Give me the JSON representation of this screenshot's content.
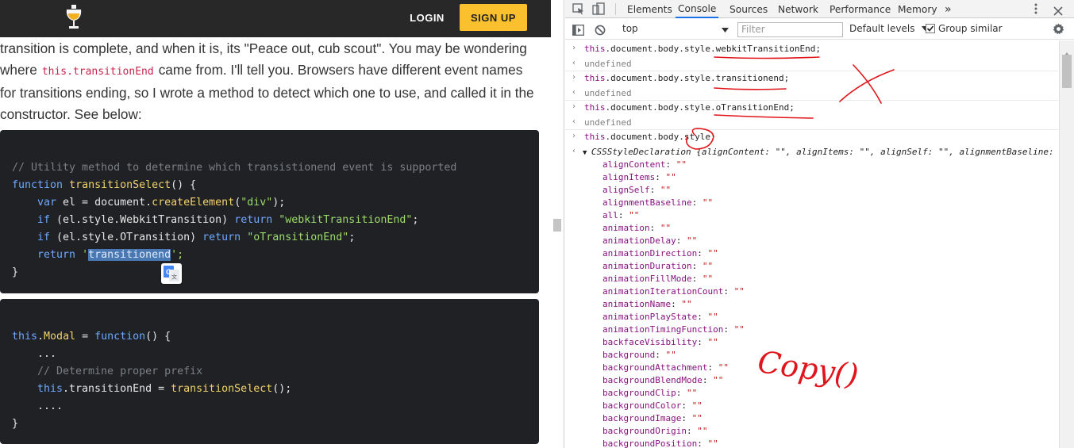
{
  "site": {
    "login_label": "LOGIN",
    "signup_label": "SIGN UP",
    "accent_color": "#fbc02d"
  },
  "article": {
    "line1": "transition is complete, and when it is, its \"Peace out, cub scout\". You may be wondering",
    "line2_a": "where",
    "line2_code": "this.transitionEnd",
    "line2_b": "came from. I'll tell you. Browsers have different event names",
    "line3": "for transitions ending, so I wrote a method to detect which one to use, and called it in the",
    "line4": "constructor. See below:"
  },
  "code1": {
    "comment": "// Utility method to determine which transistionend event is supported",
    "l2_kw": "function",
    "l2_fn": "transitionSelect",
    "l2_rest": "() {",
    "l3_kw": "var",
    "l3_a": " el = document.",
    "l3_fn": "createElement",
    "l3_b": "(",
    "l3_st": "\"div\"",
    "l3_c": ");",
    "l4_kw": "if",
    "l4_a": " (el.style.WebkitTransition) ",
    "l4_kw2": "return",
    "l4_st": "\"webkitTransitionEnd\"",
    "l4_c": ";",
    "l5_kw": "if",
    "l5_a": " (el.style.OTransition) ",
    "l5_kw2": "return",
    "l5_st": "\"oTransitionEnd\"",
    "l5_c": ";",
    "l6_kw": "return",
    "l6_q1": "'",
    "l6_hl": "transitionend",
    "l6_q2": "';",
    "l7": "}"
  },
  "code2": {
    "l1_kw": "this",
    "l1_dot": ".",
    "l1_fn": "Modal",
    "l1_eq": " = ",
    "l1_kw2": "function",
    "l1_rest": "() {",
    "l2": "...",
    "l3": "// Determine proper prefix",
    "l4_kw": "this",
    "l4_a": ".transitionEnd = ",
    "l4_fn": "transitionSelect",
    "l4_b": "();",
    "l5": "....",
    "l6": "}"
  },
  "devtools": {
    "tabs": [
      "Elements",
      "Console",
      "Sources",
      "Network",
      "Performance",
      "Memory"
    ],
    "active_tab": "Console",
    "more_tabs": "»",
    "context": "top",
    "filter_placeholder": "Filter",
    "levels": "Default levels",
    "group_similar": "Group similar"
  },
  "console": {
    "entries": [
      {
        "kw": "this",
        "text": ".document.body.style.webkitTransitionEnd;",
        "result": "undefined"
      },
      {
        "kw": "this",
        "text": ".document.body.style.transitionend;",
        "result": "undefined"
      },
      {
        "kw": "this",
        "text": ".document.body.style.oTransitionEnd;",
        "result": "undefined"
      },
      {
        "kw": "this",
        "text": ".document.body.style;"
      }
    ],
    "object_head_name": "CSSStyleDeclaration",
    "object_head_preview": " {alignContent: \"\", alignItems: \"\", alignSelf: \"\", alignmentBaseline:",
    "properties": [
      "alignContent",
      "alignItems",
      "alignSelf",
      "alignmentBaseline",
      "all",
      "animation",
      "animationDelay",
      "animationDirection",
      "animationDuration",
      "animationFillMode",
      "animationIterationCount",
      "animationName",
      "animationPlayState",
      "animationTimingFunction",
      "backfaceVisibility",
      "background",
      "backgroundAttachment",
      "backgroundBlendMode",
      "backgroundClip",
      "backgroundColor",
      "backgroundImage",
      "backgroundOrigin",
      "backgroundPosition"
    ],
    "empty_value": "\"\""
  },
  "annotation": {
    "handwriting": "Copy()",
    "ink_color": "#e0141a"
  }
}
